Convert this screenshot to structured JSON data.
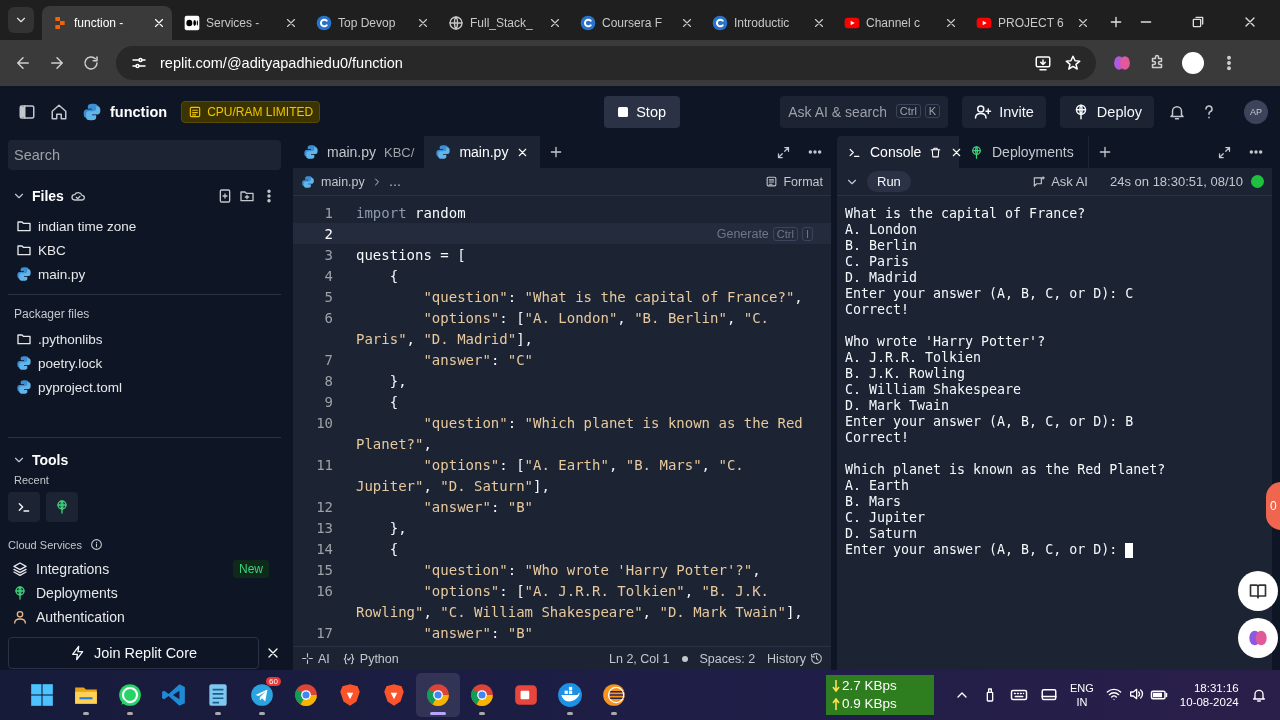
{
  "browser": {
    "tabs": [
      {
        "title": "function -",
        "kind": "replit",
        "selected": true
      },
      {
        "title": "Services -",
        "kind": "medium",
        "selected": false
      },
      {
        "title": "Top Devop",
        "kind": "coursera",
        "selected": false
      },
      {
        "title": "Full_Stack_",
        "kind": "globe",
        "selected": false
      },
      {
        "title": "Coursera F",
        "kind": "coursera",
        "selected": false
      },
      {
        "title": "Introductic",
        "kind": "coursera",
        "selected": false
      },
      {
        "title": "Channel c",
        "kind": "youtube",
        "selected": false
      },
      {
        "title": "PROJECT 6",
        "kind": "youtube",
        "selected": false
      }
    ],
    "url": "replit.com/@adityapadhiedu0/function"
  },
  "header": {
    "project": "function",
    "badge": "CPU/RAM LIMITED",
    "stop": "Stop",
    "search": {
      "placeholder": "Ask AI & search",
      "keys": [
        "Ctrl",
        "K"
      ]
    },
    "invite": "Invite",
    "deploy": "Deploy",
    "avatar": "AP"
  },
  "sidebar": {
    "search": {
      "placeholder": "Search"
    },
    "files_title": "Files",
    "files": [
      {
        "name": "indian time zone",
        "kind": "folder"
      },
      {
        "name": "KBC",
        "kind": "folder"
      },
      {
        "name": "main.py",
        "kind": "python"
      }
    ],
    "packager_title": "Packager files",
    "packager": [
      {
        "name": ".pythonlibs",
        "kind": "folder"
      },
      {
        "name": "poetry.lock",
        "kind": "python"
      },
      {
        "name": "pyproject.toml",
        "kind": "python"
      }
    ],
    "tools_title": "Tools",
    "recent_label": "Recent",
    "recent": [
      {
        "kind": "console"
      },
      {
        "kind": "deployments"
      }
    ],
    "cloud_label": "Cloud Services",
    "cloud": [
      {
        "name": "Integrations",
        "kind": "layers",
        "badge": "New"
      },
      {
        "name": "Deployments",
        "kind": "deployments"
      },
      {
        "name": "Authentication",
        "kind": "person"
      }
    ],
    "join": "Join Replit Core"
  },
  "editor": {
    "tabs": [
      {
        "title": "main.py",
        "path": "KBC/",
        "selected": false
      },
      {
        "title": "main.py",
        "selected": true
      }
    ],
    "breadcrumb": [
      "main.py",
      "…"
    ],
    "format": "Format",
    "rows": [
      {
        "number": "1",
        "keyword": "import",
        "text": " random"
      },
      {
        "number": "2",
        "current": true,
        "hint": {
          "label": "Generate",
          "keys": [
            "Ctrl",
            "I"
          ]
        }
      },
      {
        "number": "3",
        "text": "questions = ["
      },
      {
        "number": "4",
        "text": "    {"
      },
      {
        "number": "5",
        "text": "        \"question\": \"What is the capital of France?\","
      },
      {
        "number": "6",
        "text": "        \"options\": [\"A. London\", \"B. Berlin\", \"C."
      },
      {
        "text": "Paris\", \"D. Madrid\"],"
      },
      {
        "number": "7",
        "text": "        \"answer\": \"C\""
      },
      {
        "number": "8",
        "text": "    },"
      },
      {
        "number": "9",
        "text": "    {"
      },
      {
        "number": "10",
        "text": "        \"question\": \"Which planet is known as the Red"
      },
      {
        "text": "Planet?\","
      },
      {
        "number": "11",
        "text": "        \"options\": [\"A. Earth\", \"B. Mars\", \"C."
      },
      {
        "text": "Jupiter\", \"D. Saturn\"],"
      },
      {
        "number": "12",
        "text": "        \"answer\": \"B\""
      },
      {
        "number": "13",
        "text": "    },"
      },
      {
        "number": "14",
        "text": "    {"
      },
      {
        "number": "15",
        "text": "        \"question\": \"Who wrote 'Harry Potter'?\","
      },
      {
        "number": "16",
        "text": "        \"options\": [\"A. J.R.R. Tolkien\", \"B. J.K."
      },
      {
        "text": "Rowling\", \"C. William Shakespeare\", \"D. Mark Twain\"],"
      },
      {
        "number": "17",
        "text": "        \"answer\": \"B\""
      }
    ],
    "status": {
      "ai": "AI",
      "language": "Python",
      "position": "Ln 2, Col 1",
      "spaces": "Spaces: 2",
      "history": "History"
    }
  },
  "console": {
    "tabs": [
      {
        "title": "Console",
        "selected": true
      },
      {
        "title": "Deployments",
        "selected": false
      }
    ],
    "run": "Run",
    "ask_ai": "Ask AI",
    "run_info": "24s on 18:30:51, 08/10",
    "output": [
      [
        "What is the capital of France?",
        "A. London",
        "B. Berlin",
        "C. Paris",
        "D. Madrid",
        "Enter your answer (A, B, C, or D): C",
        "Correct!"
      ],
      [
        "Who wrote 'Harry Potter'?",
        "A. J.R.R. Tolkien",
        "B. J.K. Rowling",
        "C. William Shakespeare",
        "D. Mark Twain",
        "Enter your answer (A, B, C, or D): B",
        "Correct!"
      ],
      [
        "Which planet is known as the Red Planet?",
        "A. Earth",
        "B. Mars",
        "C. Jupiter",
        "D. Saturn",
        "Enter your answer (A, B, C, or D):"
      ]
    ],
    "cursor": true
  },
  "floating_badge": "0",
  "taskbar": {
    "apps": [
      {
        "kind": "start",
        "running": false,
        "selected": false
      },
      {
        "kind": "folder",
        "running": true,
        "selected": false
      },
      {
        "kind": "whatsapp",
        "running": true,
        "selected": false
      },
      {
        "kind": "vscode",
        "running": false,
        "selected": false
      },
      {
        "kind": "notepad",
        "running": true,
        "selected": false
      },
      {
        "kind": "telegram",
        "badge": "60",
        "running": true,
        "selected": false
      },
      {
        "kind": "chrome",
        "running": false,
        "selected": false
      },
      {
        "kind": "brave",
        "running": false,
        "selected": false
      },
      {
        "kind": "brave",
        "running": false,
        "selected": false
      },
      {
        "kind": "chrome",
        "running": true,
        "selected": true
      },
      {
        "kind": "chrome",
        "running": true,
        "selected": false
      },
      {
        "kind": "recorder",
        "running": false,
        "selected": false
      },
      {
        "kind": "docker",
        "running": true,
        "selected": false
      },
      {
        "kind": "eclipse",
        "running": true,
        "selected": false
      }
    ],
    "net": {
      "down": "2.7 KBps",
      "up": "0.9 KBps"
    },
    "lang": [
      "ENG",
      "IN"
    ],
    "time": "18:31:16",
    "date": "10-08-2024"
  }
}
